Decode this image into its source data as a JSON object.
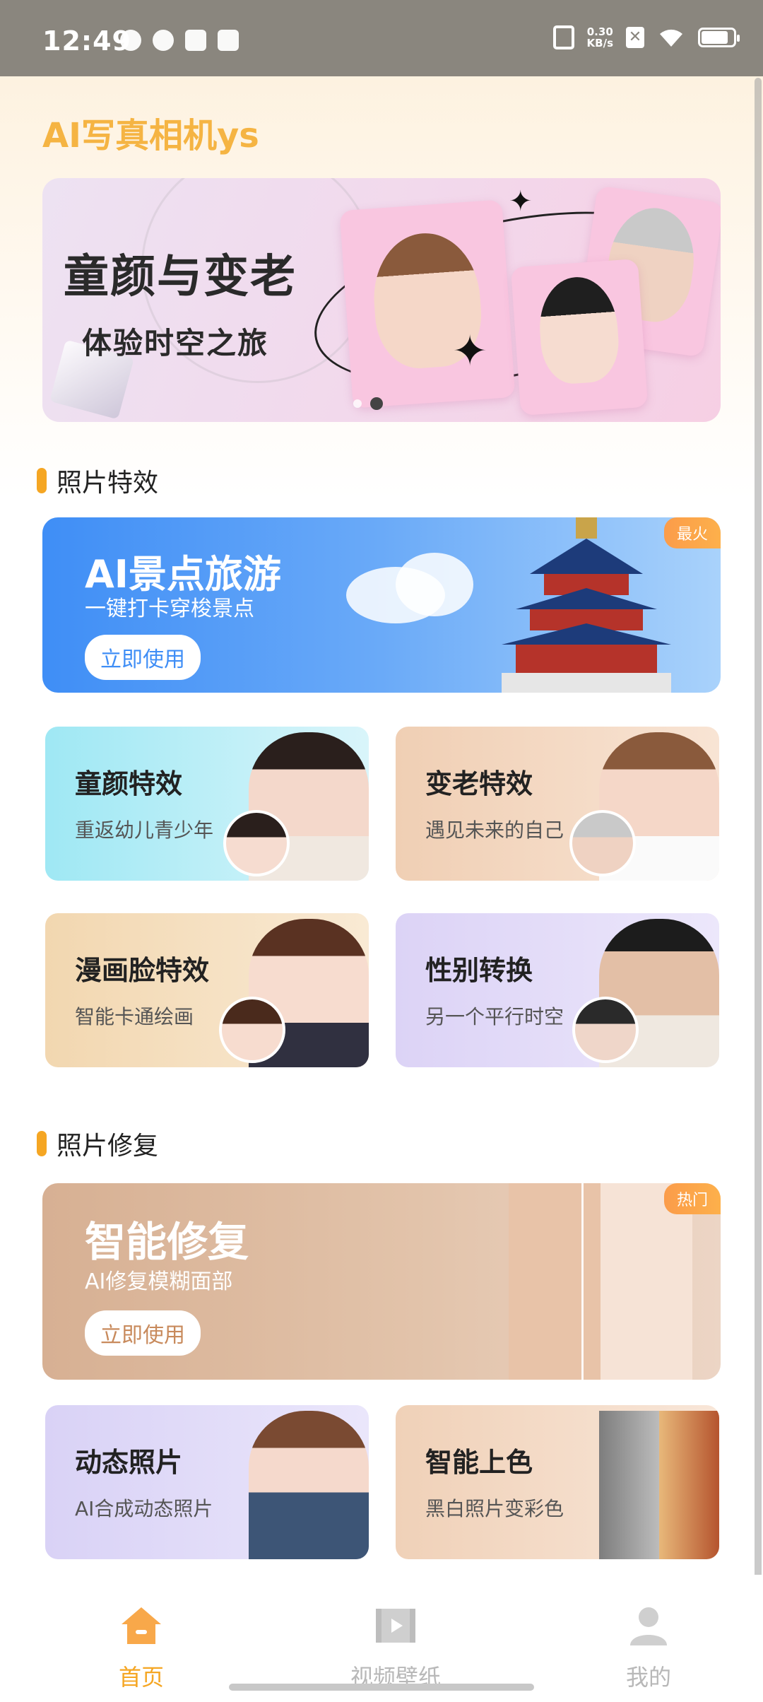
{
  "status_bar": {
    "time": "12:49",
    "net_speed_value": "0.30",
    "net_speed_unit": "KB/s",
    "battery_level": 0.85,
    "icons": [
      "notification-cat-icon",
      "leaf-icon",
      "mail-icon",
      "box-icon",
      "vibrate-icon",
      "close-box-icon",
      "wifi-icon",
      "battery-icon"
    ]
  },
  "app": {
    "title": "AI写真相机ys"
  },
  "banner": {
    "title": "童颜与变老",
    "subtitle": "体验时空之旅",
    "slides": 2,
    "active_slide": 2
  },
  "sections": {
    "photo_effects": "照片特效",
    "photo_repair": "照片修复"
  },
  "travel": {
    "title": "AI景点旅游",
    "subtitle": "一键打卡穿梭景点",
    "button": "立即使用",
    "badge": "最火"
  },
  "effects": [
    {
      "title": "童颜特效",
      "subtitle": "重返幼儿青少年"
    },
    {
      "title": "变老特效",
      "subtitle": "遇见未来的自己"
    },
    {
      "title": "漫画脸特效",
      "subtitle": "智能卡通绘画"
    },
    {
      "title": "性别转换",
      "subtitle": "另一个平行时空"
    }
  ],
  "repair": {
    "title": "智能修复",
    "subtitle": "AI修复模糊面部",
    "button": "立即使用",
    "badge": "热门"
  },
  "repair_tools": [
    {
      "title": "动态照片",
      "subtitle": "AI合成动态照片"
    },
    {
      "title": "智能上色",
      "subtitle": "黑白照片变彩色"
    }
  ],
  "nav": {
    "items": [
      {
        "label": "首页",
        "icon": "home-icon",
        "active": true
      },
      {
        "label": "视频壁纸",
        "icon": "video-icon",
        "active": false
      },
      {
        "label": "我的",
        "icon": "profile-icon",
        "active": false
      }
    ]
  },
  "colors": {
    "accent": "#f5a623",
    "title": "#f5b443",
    "travel_blue": "#3f8ef6",
    "status_bar": "#8a867e"
  }
}
